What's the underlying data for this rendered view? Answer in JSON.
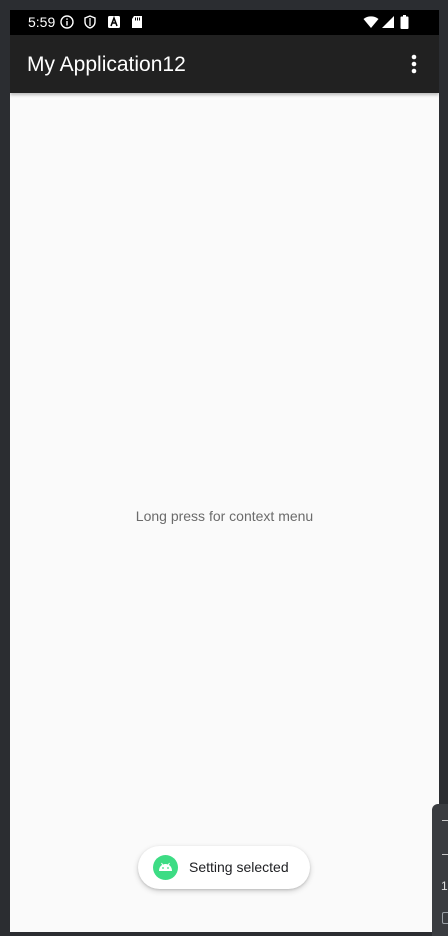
{
  "status_bar": {
    "time": "5:59",
    "left_icons": [
      "info-icon",
      "shield-icon",
      "a-badge-icon",
      "sd-card-icon"
    ],
    "right_icons": [
      "wifi-icon",
      "signal-icon",
      "battery-icon"
    ]
  },
  "app_bar": {
    "title": "My Application12",
    "overflow_icon": "more-vert-icon"
  },
  "content": {
    "hint": "Long press for context menu"
  },
  "toast": {
    "text": "Setting selected",
    "icon": "android-icon",
    "icon_color": "#3ddc84"
  },
  "side_panel": {
    "number": "1"
  },
  "colors": {
    "app_bar": "#212121",
    "status_bar": "#000000",
    "background": "#fafafa",
    "frame": "#2b2d31"
  }
}
